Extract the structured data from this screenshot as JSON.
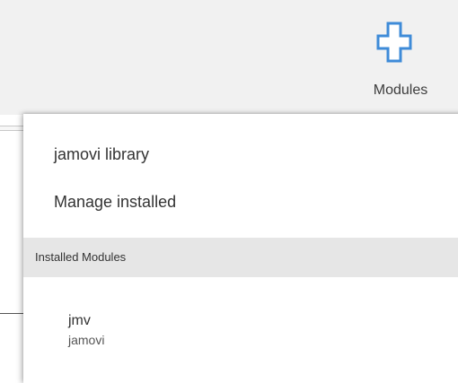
{
  "toolbar": {
    "modules_label": "Modules",
    "modules_icon": "plus-icon",
    "accent_color": "#3e8bd8"
  },
  "menu": {
    "items": [
      {
        "label": "jamovi library"
      },
      {
        "label": "Manage installed"
      }
    ],
    "section_header": "Installed Modules",
    "installed_modules": [
      {
        "name": "jmv",
        "publisher": "jamovi"
      }
    ]
  }
}
